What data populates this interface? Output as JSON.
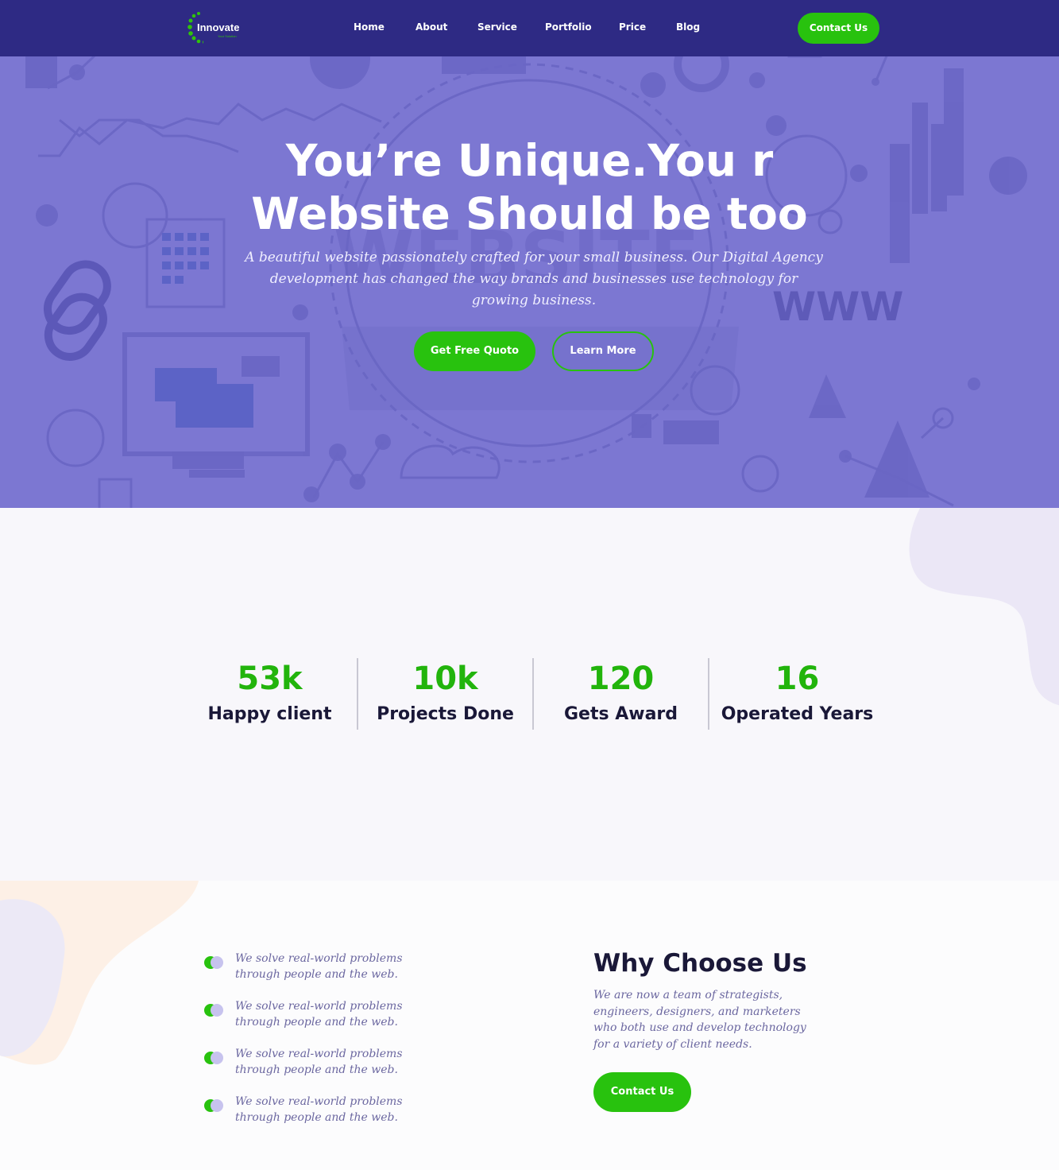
{
  "nav": {
    "logo_text": "Innovate",
    "logo_tagline": "Your Solution",
    "items": [
      {
        "label": "Home"
      },
      {
        "label": "About"
      },
      {
        "label": "Service"
      },
      {
        "label": "Portfolio"
      },
      {
        "label": "Price"
      },
      {
        "label": "Blog"
      }
    ],
    "cta_label": "Contact Us"
  },
  "hero": {
    "title_line1": "You’re Unique.You r",
    "title_line2": "Website Should be too",
    "subtitle": "A beautiful website passionately crafted for your small business. Our Digital Agency development has changed the way brands and businesses use technology for growing business.",
    "primary_button": "Get Free Quoto",
    "secondary_button": "Learn More",
    "bg_word_website": "WEBSITE",
    "bg_word_www": "WWW"
  },
  "stats": [
    {
      "number": "53k",
      "label": "Happy client"
    },
    {
      "number": "10k",
      "label": "Projects Done"
    },
    {
      "number": "120",
      "label": "Gets Award"
    },
    {
      "number": "16",
      "label": "Operated Years"
    }
  ],
  "why": {
    "title": "Why Choose Us",
    "description": "We are now a team of strategists, engineers, designers, and marketers who both use and develop technology for a variety of client needs.",
    "button": "Contact Us",
    "features": [
      {
        "text": "We solve real-world problems through people and the web."
      },
      {
        "text": "We solve real-world problems through people and the web."
      },
      {
        "text": "We solve real-world problems through people and the web."
      },
      {
        "text": "We solve real-world problems through people and the web."
      }
    ]
  },
  "colors": {
    "nav_bg": "#2e2a84",
    "hero_bg": "#7c77d2",
    "accent_green": "#28c20e",
    "heading_dark": "#1a1838",
    "body_purple": "#6b67a0"
  }
}
